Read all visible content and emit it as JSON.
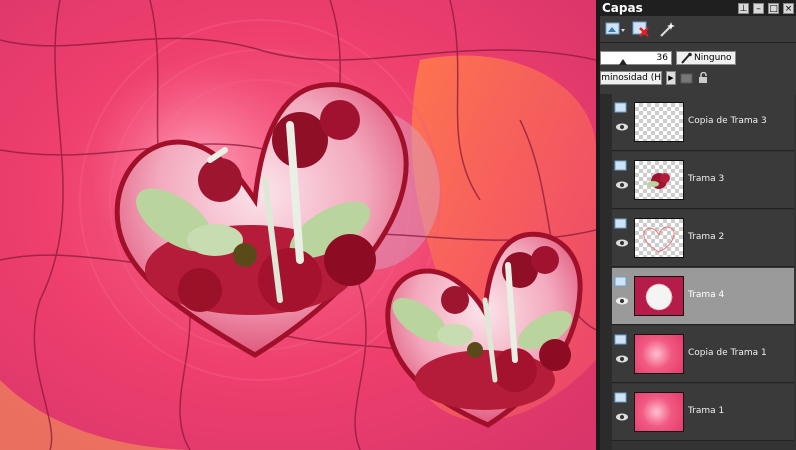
{
  "panel": {
    "title": "Capas",
    "window_buttons": [
      "pin",
      "minimize",
      "maximize",
      "close"
    ],
    "opacity_value": "36",
    "blend_label": "Ninguno",
    "mode_value": "Luminosidad (H",
    "layers": [
      {
        "name": "Copia de Trama 3",
        "thumb": "transparent",
        "selected": false
      },
      {
        "name": "Trama 3",
        "thumb": "flowers",
        "selected": false
      },
      {
        "name": "Trama 2",
        "thumb": "outline",
        "selected": false
      },
      {
        "name": "Trama 4",
        "thumb": "mask",
        "selected": true
      },
      {
        "name": "Copia de Trama 1",
        "thumb": "background",
        "selected": false
      },
      {
        "name": "Trama 1",
        "thumb": "background",
        "selected": false
      }
    ]
  },
  "colors": {
    "canvas_pink": "#e83a6b",
    "panel_bg": "#3a3a3a",
    "selected_row": "#9a9a9a",
    "heart_red": "#a0102a"
  },
  "icons": [
    "new-layer-icon",
    "delete-layer-icon",
    "mask-wand-icon",
    "brush-icon",
    "layer-type-icon",
    "eye-icon",
    "lock-icon"
  ]
}
